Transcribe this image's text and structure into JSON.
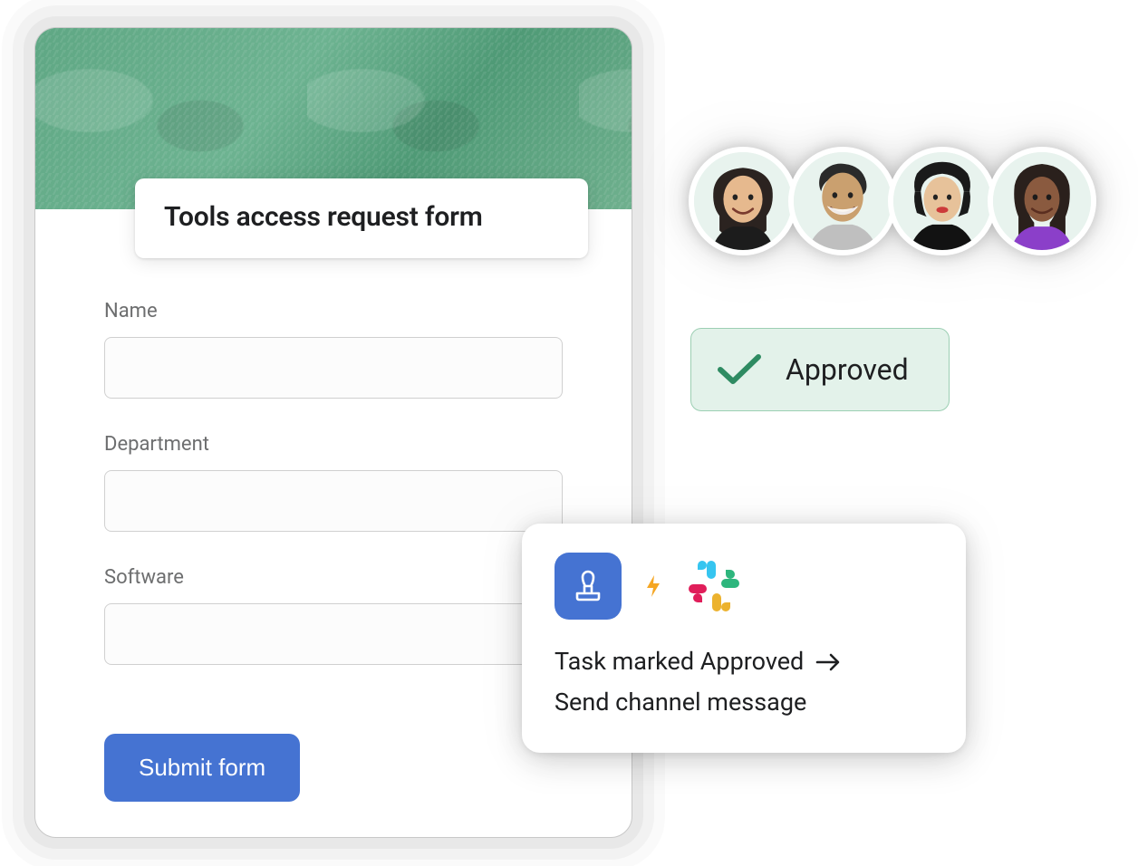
{
  "form": {
    "title": "Tools access request form",
    "fields": {
      "name": {
        "label": "Name",
        "value": ""
      },
      "department": {
        "label": "Department",
        "value": ""
      },
      "software": {
        "label": "Software",
        "value": ""
      }
    },
    "submit_label": "Submit form"
  },
  "approved": {
    "label": "Approved"
  },
  "automation": {
    "line1": "Task marked Approved",
    "line2": "Send channel message"
  }
}
